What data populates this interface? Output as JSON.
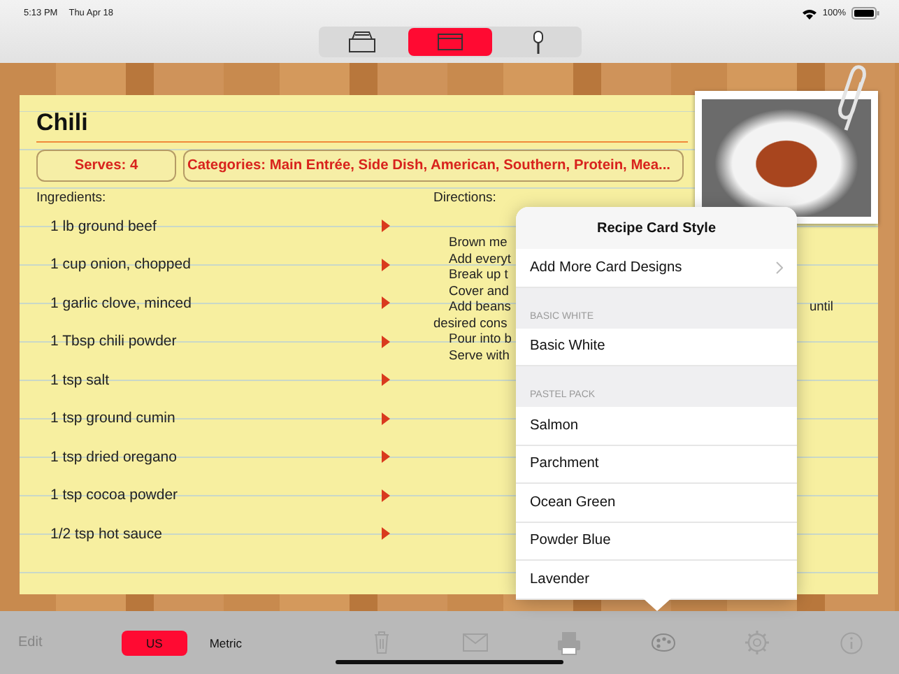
{
  "status_bar": {
    "time": "5:13 PM",
    "date": "Thu Apr 18",
    "battery": "100%"
  },
  "view_switcher": [
    {
      "kind": "box",
      "selected": false
    },
    {
      "kind": "card",
      "selected": true
    },
    {
      "kind": "mic",
      "selected": false
    }
  ],
  "recipe": {
    "title": "Chili",
    "serves": "Serves: 4",
    "categories": "Categories: Main Entrée, Side Dish, American, Southern, Protein, Mea...",
    "ingredients_label": "Ingredients:",
    "directions_label": "Directions:",
    "ingredients": [
      "1 lb ground beef",
      "1 cup onion, chopped",
      "1 garlic clove, minced",
      "1 Tbsp chili powder",
      "1 tsp salt",
      "1 tsp ground cumin",
      "1 tsp dried oregano",
      "1 tsp cocoa powder",
      "1/2 tsp hot sauce"
    ],
    "directions": [
      {
        "text": "Brown me",
        "indented": true
      },
      {
        "text": "Add everyt",
        "indented": true
      },
      {
        "text": "Break up t",
        "indented": true
      },
      {
        "text": "Cover and",
        "indented": true
      },
      {
        "text": "Add beans",
        "indented": true,
        "tail": "until"
      },
      {
        "text": "desired cons",
        "indented": false
      },
      {
        "text": "Pour into b",
        "indented": true
      },
      {
        "text": "Serve with",
        "indented": true
      }
    ]
  },
  "popover": {
    "title": "Recipe Card Style",
    "items": [
      {
        "kind": "link",
        "label": "Add More Card Designs"
      },
      {
        "kind": "header",
        "label": "BASIC WHITE"
      },
      {
        "kind": "item",
        "label": "Basic White"
      },
      {
        "kind": "header",
        "label": "PASTEL PACK"
      },
      {
        "kind": "item",
        "label": "Salmon"
      },
      {
        "kind": "item",
        "label": "Parchment"
      },
      {
        "kind": "item",
        "label": "Ocean Green"
      },
      {
        "kind": "item",
        "label": "Powder Blue"
      },
      {
        "kind": "item",
        "label": "Lavender"
      }
    ]
  },
  "toolbar": {
    "edit": {
      "label": "Edit",
      "disabled": true
    },
    "units": [
      {
        "label": "US",
        "selected": true
      },
      {
        "label": "Metric",
        "selected": false
      }
    ],
    "tools": [
      {
        "kind": "trash",
        "active": false
      },
      {
        "kind": "mail",
        "active": false
      },
      {
        "kind": "printer",
        "active": false
      },
      {
        "kind": "palette",
        "active": true
      },
      {
        "kind": "gear",
        "active": false
      },
      {
        "kind": "info",
        "active": false
      }
    ]
  }
}
